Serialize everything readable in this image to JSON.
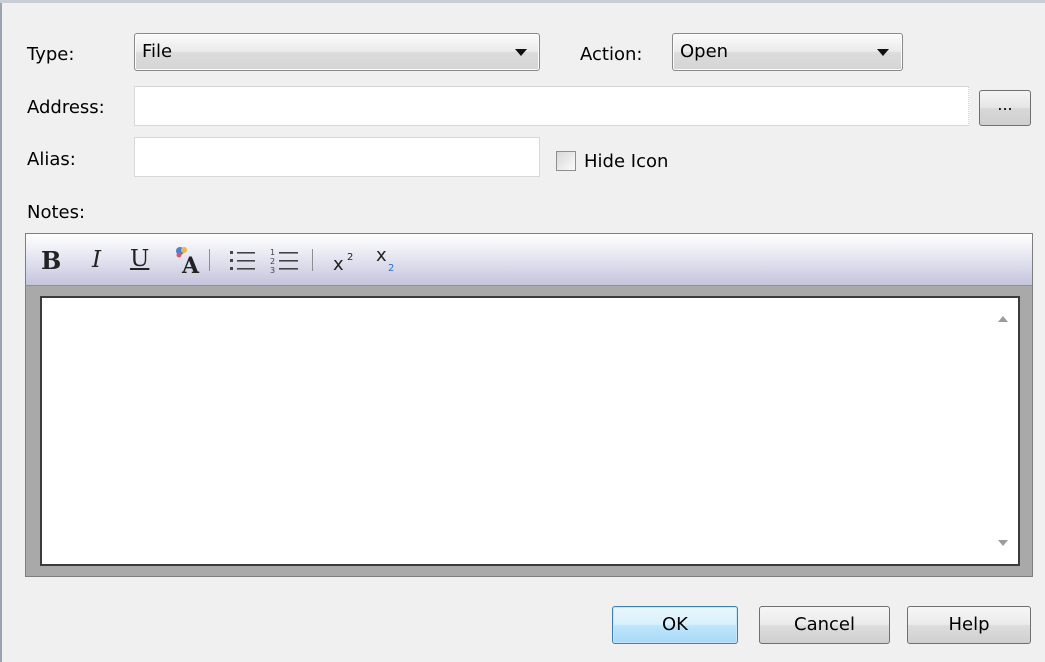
{
  "form": {
    "type_label": "Type:",
    "type_value": "File",
    "action_label": "Action:",
    "action_value": "Open",
    "address_label": "Address:",
    "address_value": "",
    "browse_label": "...",
    "alias_label": "Alias:",
    "alias_value": "",
    "hide_icon_label": "Hide Icon",
    "hide_icon_checked": false,
    "notes_label": "Notes:",
    "notes_value": ""
  },
  "editor_toolbar": {
    "bold": "B",
    "italic": "I",
    "underline": "U",
    "font_color_icon": "font-color-icon",
    "bullet_list_icon": "bullet-list-icon",
    "numbered_list_icon": "numbered-list-icon",
    "superscript_icon": "superscript-icon",
    "subscript_icon": "subscript-icon"
  },
  "buttons": {
    "ok": "OK",
    "cancel": "Cancel",
    "help": "Help"
  },
  "colors": {
    "toolbar_accent": "#c4c5dc",
    "default_button": "#bee6fd"
  }
}
